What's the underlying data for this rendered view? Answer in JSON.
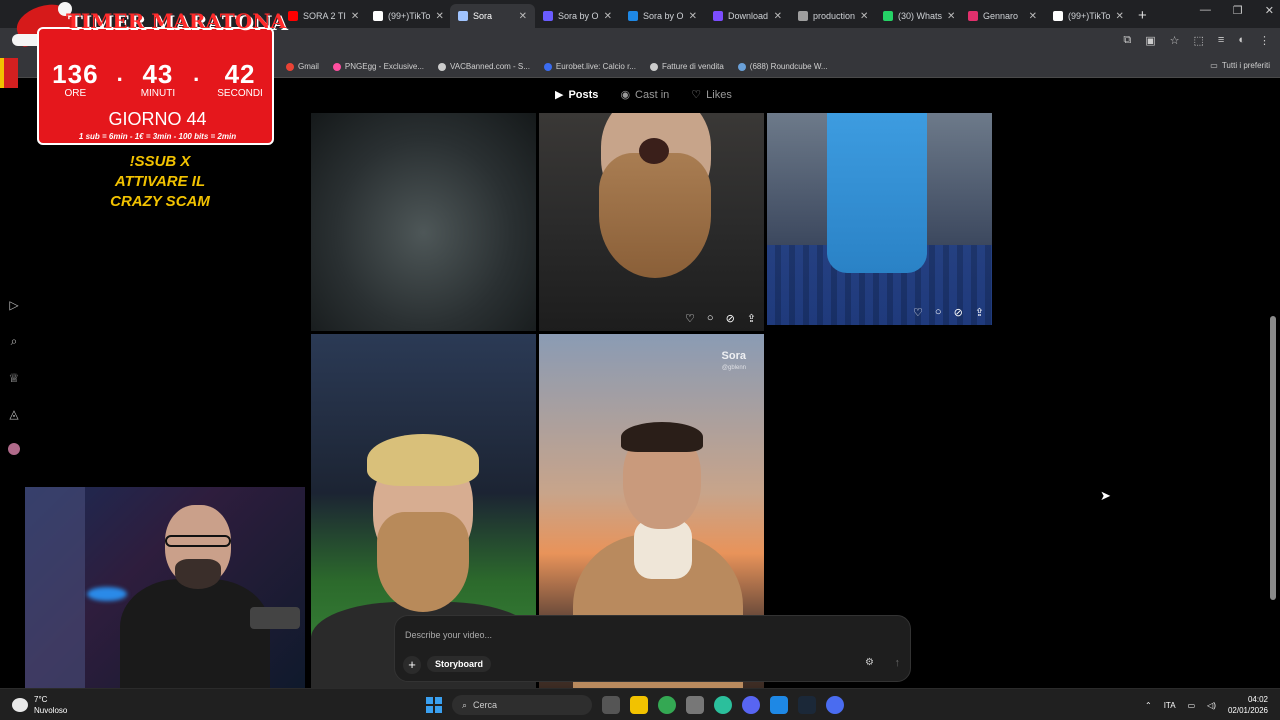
{
  "browser": {
    "tabs": [
      {
        "title": "SORA 2 TI",
        "color": "#ff0000"
      },
      {
        "title": "(99+)TikTo",
        "color": "#ffffff"
      },
      {
        "title": "Sora",
        "color": "#a0c4ff",
        "active": true
      },
      {
        "title": "Sora by O",
        "color": "#6a5cff"
      },
      {
        "title": "Sora by O",
        "color": "#1e88e5"
      },
      {
        "title": "Download",
        "color": "#7c4dff"
      },
      {
        "title": "production",
        "color": "#9e9e9e"
      },
      {
        "title": "(30) Whats",
        "color": "#25d366"
      },
      {
        "title": "Gennaro",
        "color": "#e1306c"
      },
      {
        "title": "(99+)TikTo",
        "color": "#ffffff"
      }
    ],
    "bookmarks": [
      "Gmail",
      "PNGEgg - Exclusive...",
      "VACBanned.com - S...",
      "Eurobet.live: Calcio r...",
      "Fatture di vendita",
      "(688) Roundcube W..."
    ],
    "bookmarks_right": "Tutti i preferiti"
  },
  "profile_nav": {
    "tabs": [
      {
        "label": "Posts",
        "icon": "play-square-icon"
      },
      {
        "label": "Cast in",
        "icon": "person-circle-icon"
      },
      {
        "label": "Likes",
        "icon": "heart-icon"
      }
    ]
  },
  "sora_tiles": {
    "watermark": "Sora",
    "watermark_handle": "@gblenn"
  },
  "prompt": {
    "placeholder": "Describe your video...",
    "storyboard_label": "Storyboard"
  },
  "overlay": {
    "timer_title": "TIMER MARATONA",
    "hours": "136",
    "minutes": "43",
    "seconds": "42",
    "hours_label": "ORE",
    "minutes_label": "MINUTI",
    "seconds_label": "SECONDI",
    "day": "GIORNO 44",
    "rates": "1 sub = 6min - 1€ = 3min - 100 bits = 2min",
    "cta_line1": "!SSUB X",
    "cta_line2": "ATTIVARE IL",
    "cta_line3": "CRAZY SCAM"
  },
  "taskbar": {
    "temperature": "7°C",
    "weather": "Nuvoloso",
    "search_label": "Cerca",
    "language": "ITA",
    "time": "04:02",
    "date": "02/01/2026"
  }
}
